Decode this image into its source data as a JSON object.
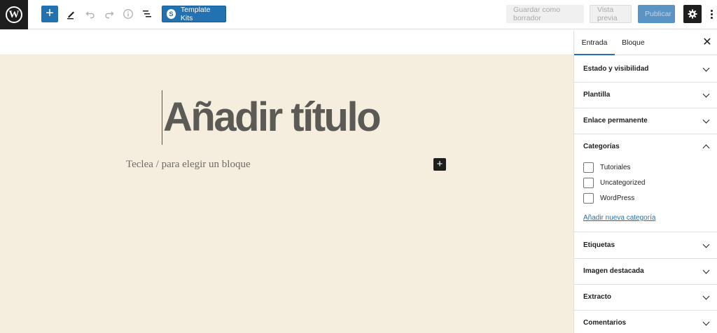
{
  "toolbar": {
    "logo_letter": "W",
    "template_kits_label": "Template Kits",
    "template_kits_icon_letter": "S",
    "save_draft_label": "Guardar como borrador",
    "preview_label": "Vista previa",
    "publish_label": "Publicar",
    "icons": [
      "wordpress-logo",
      "add-block",
      "pencil-tools",
      "undo",
      "redo",
      "info",
      "list-view",
      "gear",
      "more-vertical"
    ]
  },
  "editor": {
    "title_placeholder": "Añadir título",
    "block_placeholder": "Teclea / para elegir un bloque",
    "canvas_color": "#f5eedf"
  },
  "sidebar": {
    "tabs": [
      {
        "label": "Entrada",
        "active": true
      },
      {
        "label": "Bloque",
        "active": false
      }
    ],
    "panels": [
      {
        "title": "Estado y visibilidad",
        "expanded": false
      },
      {
        "title": "Plantilla",
        "expanded": false
      },
      {
        "title": "Enlace permanente",
        "expanded": false
      },
      {
        "title": "Categorías",
        "expanded": true
      },
      {
        "title": "Etiquetas",
        "expanded": false
      },
      {
        "title": "Imagen destacada",
        "expanded": false
      },
      {
        "title": "Extracto",
        "expanded": false
      },
      {
        "title": "Comentarios",
        "expanded": false
      }
    ],
    "categories": [
      {
        "label": "Tutoriales",
        "checked": false
      },
      {
        "label": "Uncategorized",
        "checked": false
      },
      {
        "label": "WordPress",
        "checked": false
      }
    ],
    "add_category_label": "Añadir nueva categoría"
  },
  "colors": {
    "accent": "#2271b1",
    "dark": "#1e1e1e"
  }
}
